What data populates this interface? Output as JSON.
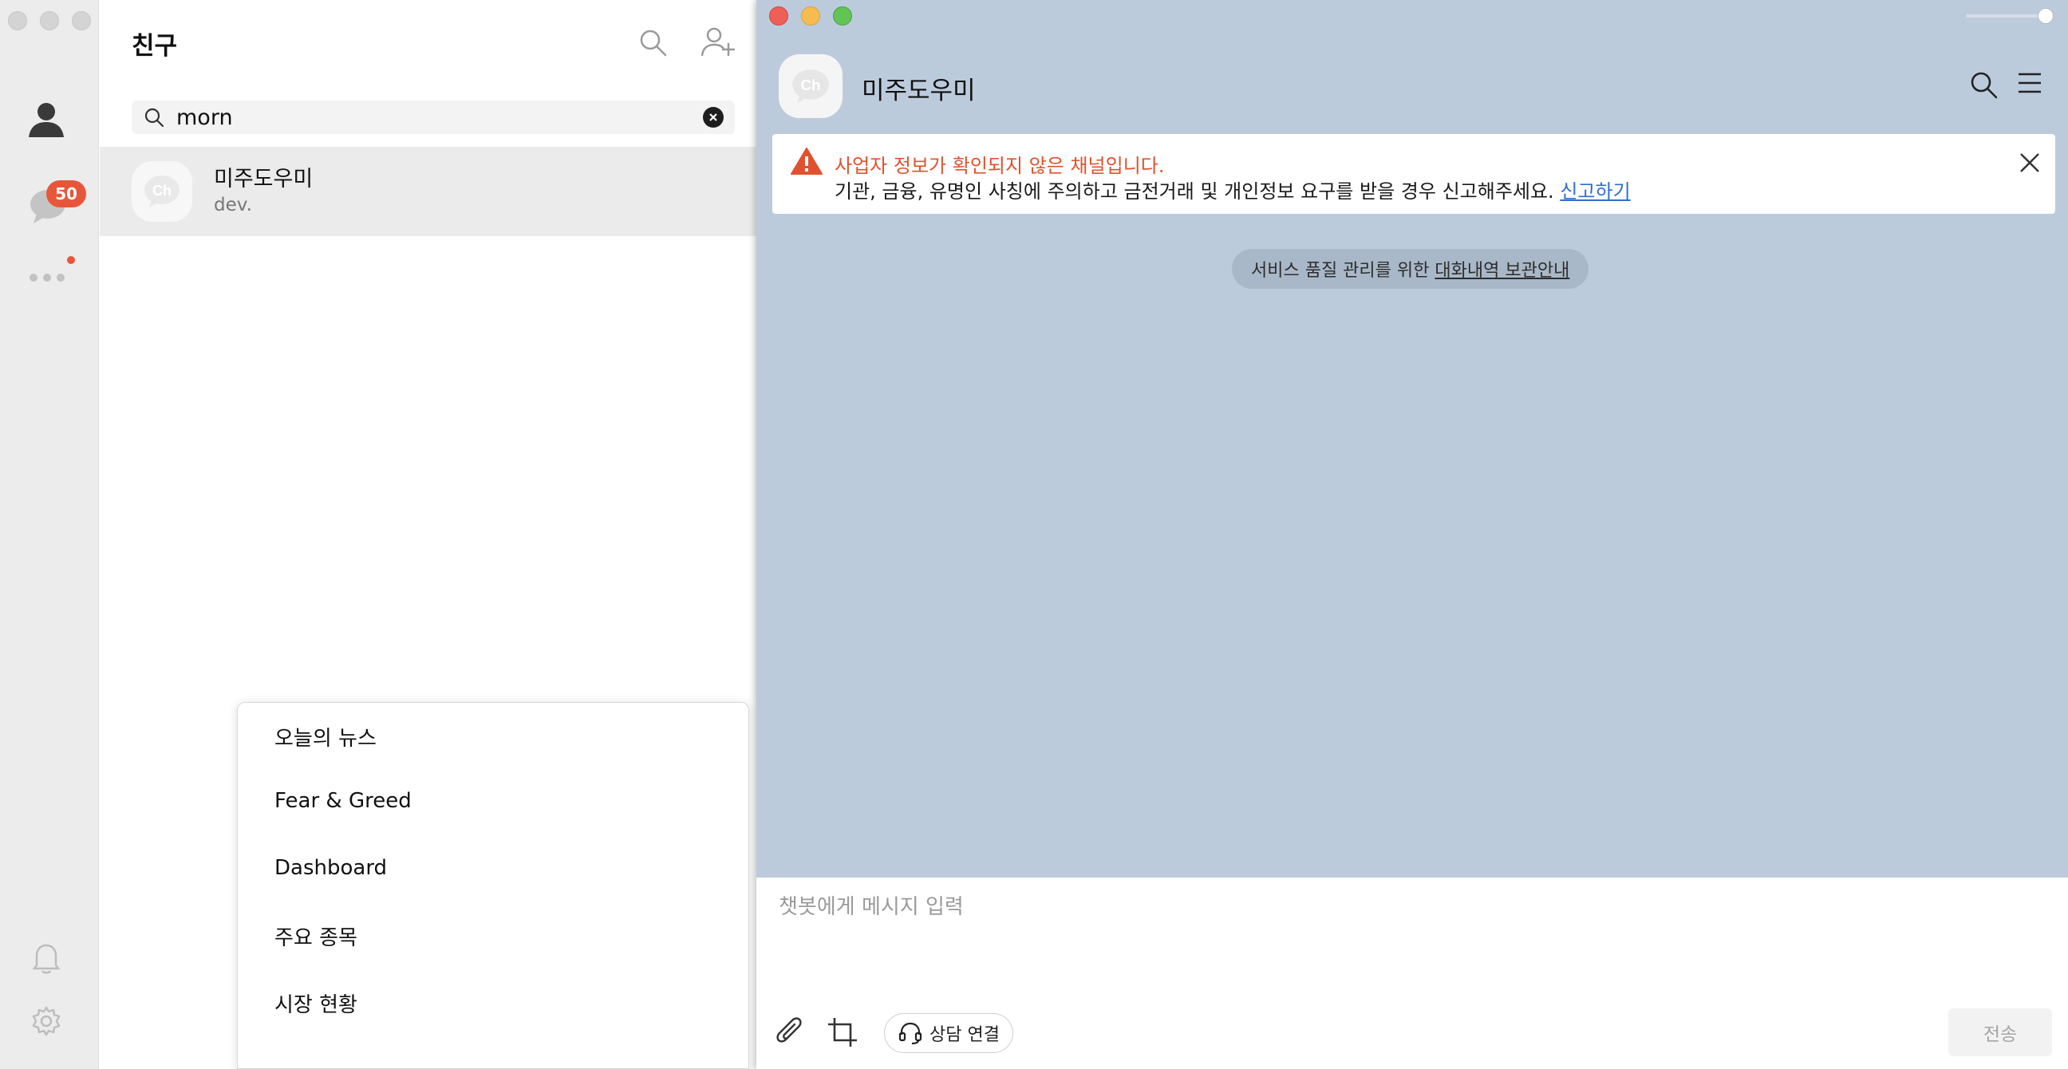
{
  "friends": {
    "title": "친구",
    "search": {
      "value": "morn"
    },
    "result": {
      "avatar_text": "Ch",
      "name": "미주도우미",
      "subtitle": "dev."
    }
  },
  "sidebar": {
    "chat_badge": "50"
  },
  "popup_menu": {
    "items": [
      "오늘의 뉴스",
      "Fear & Greed",
      "Dashboard",
      "주요 종목",
      "시장 현황"
    ]
  },
  "chat": {
    "title": "미주도우미",
    "avatar_text": "Ch",
    "warning": {
      "title": "사업자 정보가 확인되지 않은 채널입니다.",
      "body": "기관, 금융, 유명인 사칭에 주의하고 금전거래 및 개인정보 요구를 받을 경우 신고해주세요.",
      "link": "신고하기"
    },
    "notice": {
      "prefix": "서비스 품질 관리를 위한",
      "link": "대화내역 보관안내"
    },
    "input": {
      "placeholder": "챗봇에게 메시지 입력"
    },
    "consult_label": "상담 연결",
    "send_label": "전송"
  },
  "colors": {
    "chat_bg": "#bccbdc",
    "badge": "#e8563a",
    "warning_text": "#e0522f",
    "link": "#2f6ecf",
    "traffic_red": "#ed5f57",
    "traffic_yellow": "#f5bd4f",
    "traffic_green": "#61c454"
  }
}
